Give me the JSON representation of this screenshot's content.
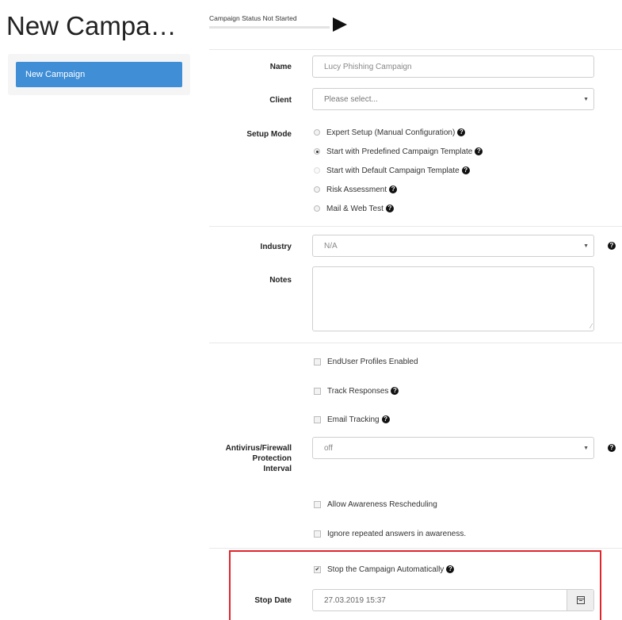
{
  "page": {
    "title": "New Campa…"
  },
  "sidebar": {
    "items": [
      {
        "label": "New Campaign"
      }
    ]
  },
  "status": {
    "label": "Campaign Status  Not Started"
  },
  "form": {
    "name": {
      "label": "Name",
      "value": "Lucy Phishing Campaign"
    },
    "client": {
      "label": "Client",
      "value": "Please select..."
    },
    "setup_mode": {
      "label": "Setup Mode",
      "options": [
        {
          "label": "Expert Setup (Manual Configuration)",
          "checked": false,
          "help": true
        },
        {
          "label": "Start with Predefined Campaign Template",
          "checked": true,
          "help": true
        },
        {
          "label": "Start with Default Campaign Template",
          "checked": false,
          "help": true
        },
        {
          "label": "Risk Assessment",
          "checked": false,
          "help": true
        },
        {
          "label": "Mail & Web Test",
          "checked": false,
          "help": true
        }
      ]
    },
    "industry": {
      "label": "Industry",
      "value": "N/A"
    },
    "notes": {
      "label": "Notes",
      "value": ""
    },
    "checkboxes": [
      {
        "label": "EndUser Profiles Enabled",
        "checked": false
      },
      {
        "label": "Track Responses",
        "checked": false
      },
      {
        "label": "Email Tracking",
        "checked": false
      }
    ],
    "antivirus": {
      "label_lines": [
        "Antivirus/Firewall",
        "Protection",
        "Interval"
      ],
      "value": "off"
    },
    "awareness": [
      {
        "label": "Allow Awareness Rescheduling",
        "checked": false
      },
      {
        "label": "Ignore repeated answers in awareness.",
        "checked": false
      }
    ],
    "stop_auto": {
      "label": "Stop the Campaign Automatically",
      "checked": true
    },
    "stop_date": {
      "label": "Stop Date",
      "value": "27.03.2019 15:37"
    }
  },
  "icons": {
    "help": "?",
    "check": "✔",
    "caret": "▼",
    "resize": "⁄"
  },
  "colors": {
    "accent": "#3f8ed6",
    "highlight": "#e0242b"
  }
}
